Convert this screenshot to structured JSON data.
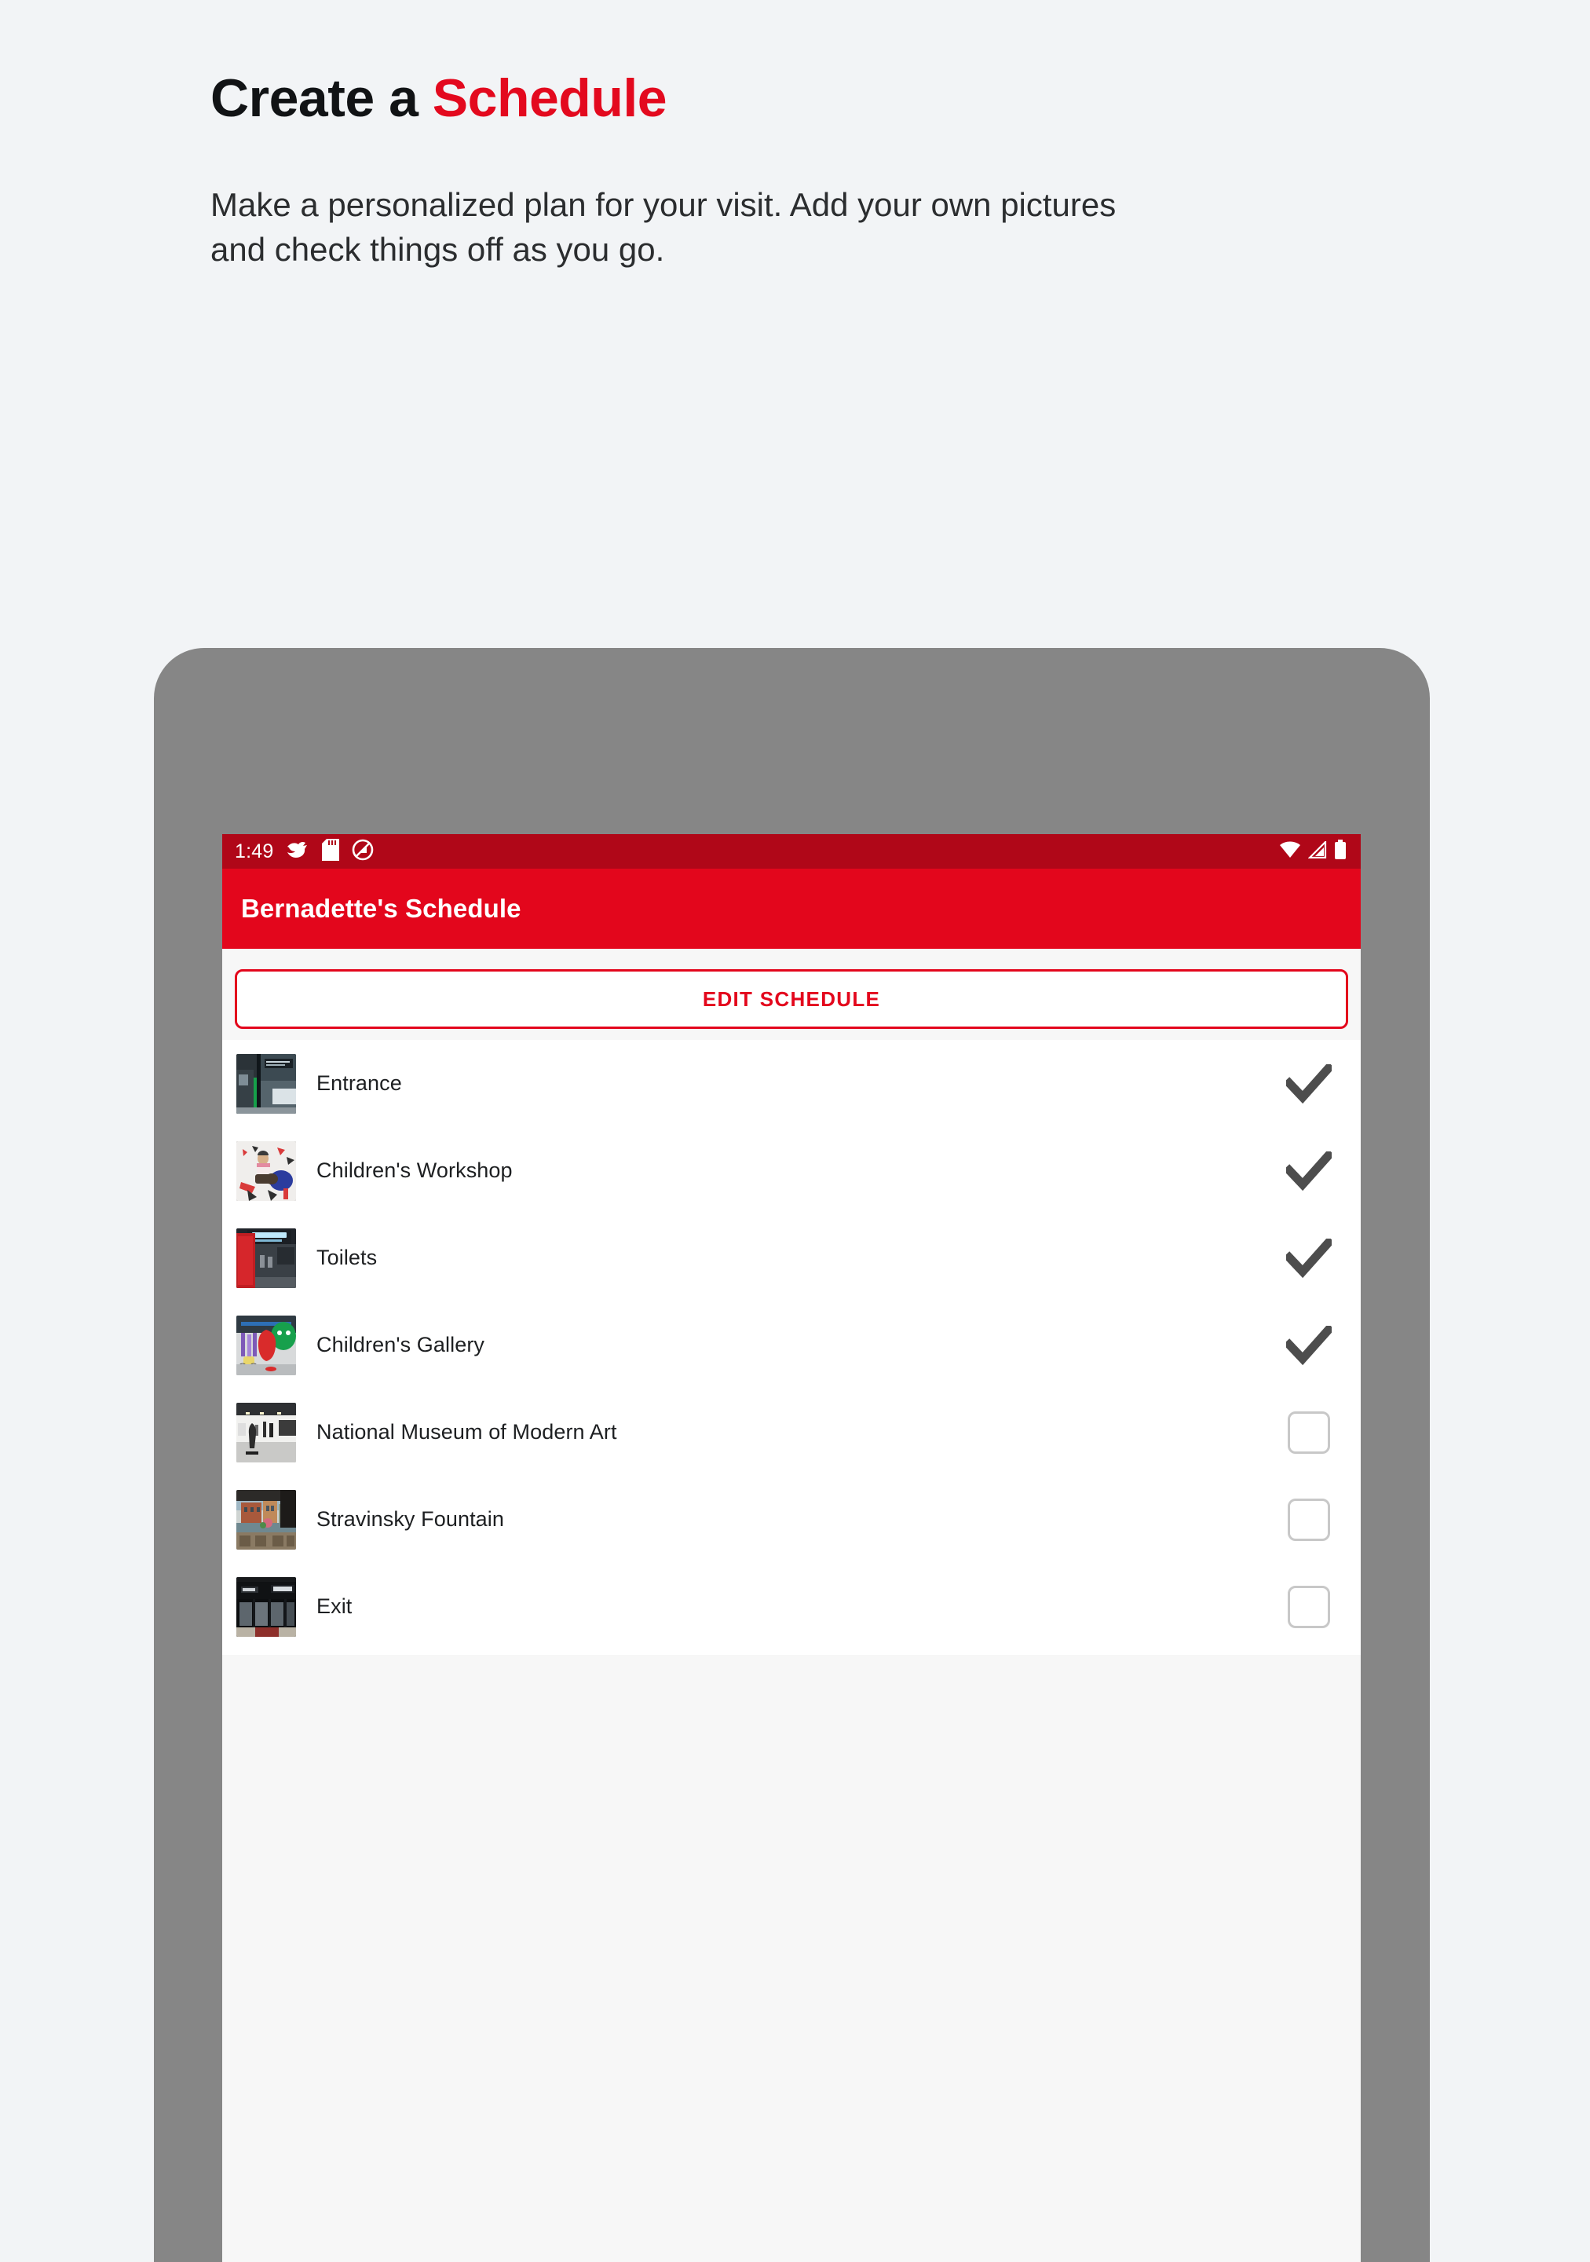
{
  "promo": {
    "headline_prefix": "Create a ",
    "headline_accent": "Schedule",
    "subcopy_line1": "Make a personalized plan for your visit. Add your own pictures",
    "subcopy_line2": "and check things off as you go.",
    "accent_color": "#e3091e",
    "background_color": "#f2f4f6"
  },
  "device": {
    "frame_color": "#868686",
    "screen_background": "#f7f7f7"
  },
  "status_bar": {
    "time": "1:49",
    "background_color": "#b00718",
    "left_icons": [
      "bird-icon",
      "sd-card-icon",
      "do-not-disturb-icon"
    ],
    "right_icons": [
      "wifi-icon",
      "cellular-signal-icon",
      "battery-icon"
    ]
  },
  "app_bar": {
    "title": "Bernadette's Schedule",
    "background_color": "#e3061c",
    "text_color": "#ffffff"
  },
  "actions": {
    "edit_schedule_label": "EDIT SCHEDULE",
    "edit_schedule_border_color": "#e3061c"
  },
  "schedule": {
    "checked_color": "#4d4d4d",
    "unchecked_border_color": "#c8c8c8",
    "items": [
      {
        "label": "Entrance",
        "checked": true,
        "thumbnail": "entrance-photo"
      },
      {
        "label": "Children's Workshop",
        "checked": true,
        "thumbnail": "childrens-workshop-photo"
      },
      {
        "label": "Toilets",
        "checked": true,
        "thumbnail": "toilets-photo"
      },
      {
        "label": "Children's Gallery",
        "checked": true,
        "thumbnail": "childrens-gallery-photo"
      },
      {
        "label": "National Museum of Modern Art",
        "checked": false,
        "thumbnail": "modern-art-museum-photo"
      },
      {
        "label": "Stravinsky Fountain",
        "checked": false,
        "thumbnail": "stravinsky-fountain-photo"
      },
      {
        "label": "Exit",
        "checked": false,
        "thumbnail": "exit-photo"
      }
    ]
  }
}
